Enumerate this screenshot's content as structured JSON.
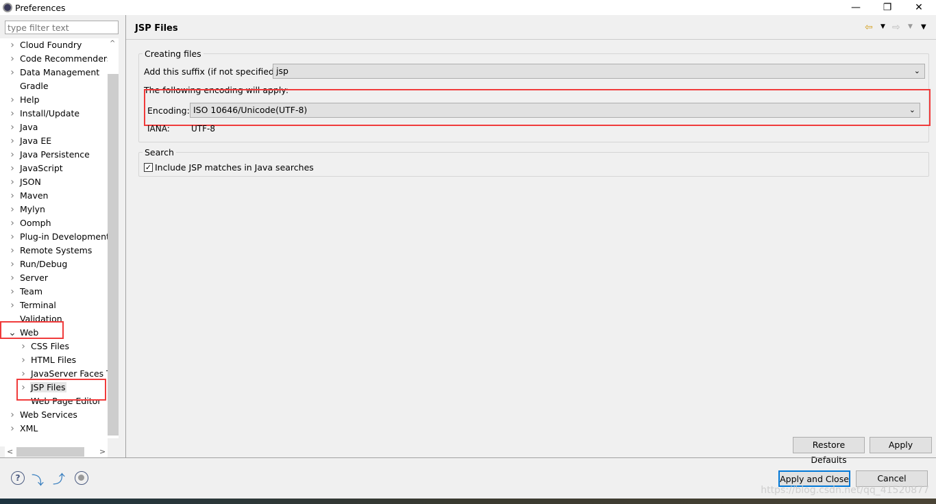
{
  "window": {
    "title": "Preferences",
    "minimize": "—",
    "restore": "❐",
    "close": "✕"
  },
  "filter": {
    "placeholder": "type filter text"
  },
  "tree": [
    {
      "label": "Cloud Foundry",
      "exp": ">"
    },
    {
      "label": "Code Recommenders",
      "exp": ">"
    },
    {
      "label": "Data Management",
      "exp": ">"
    },
    {
      "label": "Gradle",
      "exp": ""
    },
    {
      "label": "Help",
      "exp": ">"
    },
    {
      "label": "Install/Update",
      "exp": ">"
    },
    {
      "label": "Java",
      "exp": ">"
    },
    {
      "label": "Java EE",
      "exp": ">"
    },
    {
      "label": "Java Persistence",
      "exp": ">"
    },
    {
      "label": "JavaScript",
      "exp": ">"
    },
    {
      "label": "JSON",
      "exp": ">"
    },
    {
      "label": "Maven",
      "exp": ">"
    },
    {
      "label": "Mylyn",
      "exp": ">"
    },
    {
      "label": "Oomph",
      "exp": ">"
    },
    {
      "label": "Plug-in Development",
      "exp": ">"
    },
    {
      "label": "Remote Systems",
      "exp": ">"
    },
    {
      "label": "Run/Debug",
      "exp": ">"
    },
    {
      "label": "Server",
      "exp": ">"
    },
    {
      "label": "Team",
      "exp": ">"
    },
    {
      "label": "Terminal",
      "exp": ">"
    },
    {
      "label": "Validation",
      "exp": ""
    },
    {
      "label": "Web",
      "exp": "v"
    },
    {
      "label": "CSS Files",
      "exp": ">",
      "child": true
    },
    {
      "label": "HTML Files",
      "exp": ">",
      "child": true
    },
    {
      "label": "JavaServer Faces Tools",
      "exp": ">",
      "child": true
    },
    {
      "label": "JSP Files",
      "exp": ">",
      "child": true,
      "selected": true
    },
    {
      "label": "Web Page Editor",
      "exp": "",
      "child": true
    },
    {
      "label": "Web Services",
      "exp": ">"
    },
    {
      "label": "XML",
      "exp": ">"
    }
  ],
  "page": {
    "title": "JSP Files",
    "creating": {
      "legend": "Creating files",
      "suffix_label": "Add this suffix (if not specified):",
      "suffix_value": "jsp",
      "encoding_note": "The following encoding will apply:",
      "encoding_label": "Encoding:",
      "encoding_value": "ISO 10646/Unicode(UTF-8)",
      "iana_label": "IANA:",
      "iana_value": "UTF-8"
    },
    "search": {
      "legend": "Search",
      "checkbox_label": "Include JSP matches in Java searches",
      "checked": true
    },
    "restore_defaults": "Restore Defaults",
    "apply": "Apply"
  },
  "footer": {
    "apply_close": "Apply and Close",
    "cancel": "Cancel"
  },
  "watermark": "https://blog.csdn.net/qq_41520877",
  "colors": {
    "highlight": "#f03a3a",
    "selection": "#e5e5e5",
    "default_button_border": "#0078d7"
  }
}
